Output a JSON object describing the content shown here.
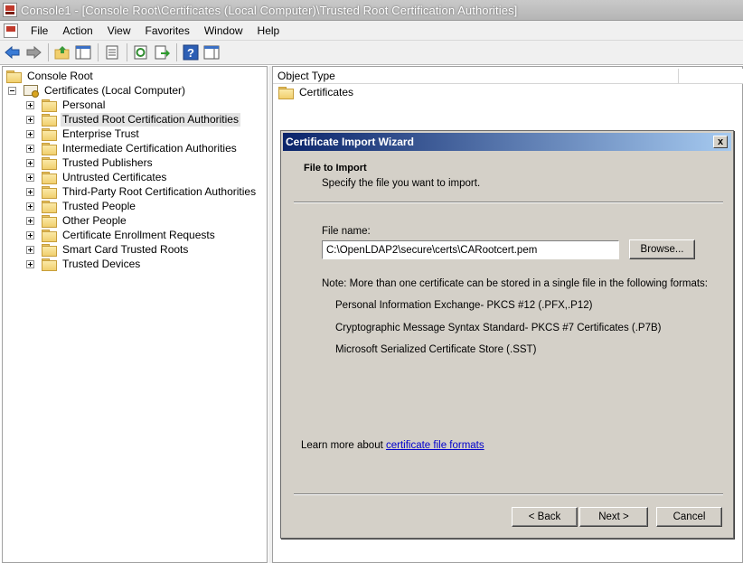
{
  "window": {
    "title": "Console1 - [Console Root\\Certificates (Local Computer)\\Trusted Root Certification Authorities]"
  },
  "menu": [
    "File",
    "Action",
    "View",
    "Favorites",
    "Window",
    "Help"
  ],
  "toolbar": {
    "icons": [
      "back-arrow-icon",
      "forward-arrow-icon",
      "up-folder-icon",
      "show-hide-tree-icon",
      "properties-icon",
      "refresh-icon",
      "export-list-icon",
      "help-icon",
      "show-action-pane-icon"
    ]
  },
  "tree": {
    "root": "Console Root",
    "certificates": "Certificates (Local Computer)",
    "items": [
      "Personal",
      "Trusted Root Certification Authorities",
      "Enterprise Trust",
      "Intermediate Certification Authorities",
      "Trusted Publishers",
      "Untrusted Certificates",
      "Third-Party Root Certification Authorities",
      "Trusted People",
      "Other People",
      "Certificate Enrollment Requests",
      "Smart Card Trusted Roots",
      "Trusted Devices"
    ],
    "selected": "Trusted Root Certification Authorities"
  },
  "list": {
    "column_header": "Object Type",
    "rows": [
      "Certificates"
    ]
  },
  "wizard": {
    "title": "Certificate Import Wizard",
    "close_label": "x",
    "header_title": "File to Import",
    "header_subtitle": "Specify the file you want to import.",
    "file_name_label": "File name:",
    "file_name_value": "C:\\OpenLDAP2\\secure\\certs\\CARootcert.pem",
    "browse_label": "Browse...",
    "note": "Note:  More than one certificate can be stored in a single file in the following formats:",
    "formats": [
      "Personal Information Exchange- PKCS #12 (.PFX,.P12)",
      "Cryptographic Message Syntax Standard- PKCS #7 Certificates (.P7B)",
      "Microsoft Serialized Certificate Store (.SST)"
    ],
    "learn_more_prefix": "Learn more about ",
    "learn_more_link": "certificate file formats",
    "back_label": "< Back",
    "next_label": "Next >",
    "cancel_label": "Cancel"
  }
}
